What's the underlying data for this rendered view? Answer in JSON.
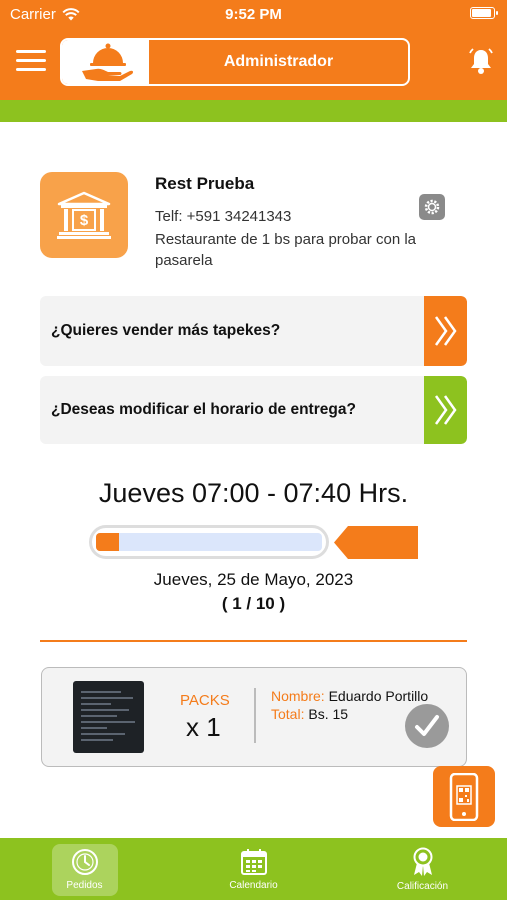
{
  "status_bar": {
    "carrier": "Carrier",
    "time": "9:52 PM"
  },
  "header": {
    "title": "Administrador"
  },
  "restaurant": {
    "name": "Rest Prueba",
    "phone": "Telf: +591 34241343",
    "description": "Restaurante de 1 bs para probar con la pasarela"
  },
  "promos": [
    {
      "label": "¿Quieres vender más tapekes?"
    },
    {
      "label": "¿Deseas modificar el horario de entrega?"
    }
  ],
  "schedule": {
    "title": "Jueves 07:00 - 07:40 Hrs.",
    "progress_fraction": 0.1,
    "date": "Jueves,  25 de Mayo, 2023",
    "count": "( 1 / 10 )"
  },
  "order": {
    "packs_label": "PACKS",
    "quantity": "x 1",
    "name_key": "Nombre:",
    "name_value": "Eduardo Portillo",
    "total_key": "Total:",
    "total_value": "Bs. 15"
  },
  "bottom_nav": [
    {
      "label": "Pedidos",
      "icon": "clock-icon",
      "active": true
    },
    {
      "label": "Calendario",
      "icon": "calendar-icon",
      "active": false
    },
    {
      "label": "Calificación",
      "icon": "award-icon",
      "active": false
    }
  ],
  "colors": {
    "orange": "#F47C1B",
    "green": "#8DC21F",
    "light_orange": "#F8A24A"
  }
}
